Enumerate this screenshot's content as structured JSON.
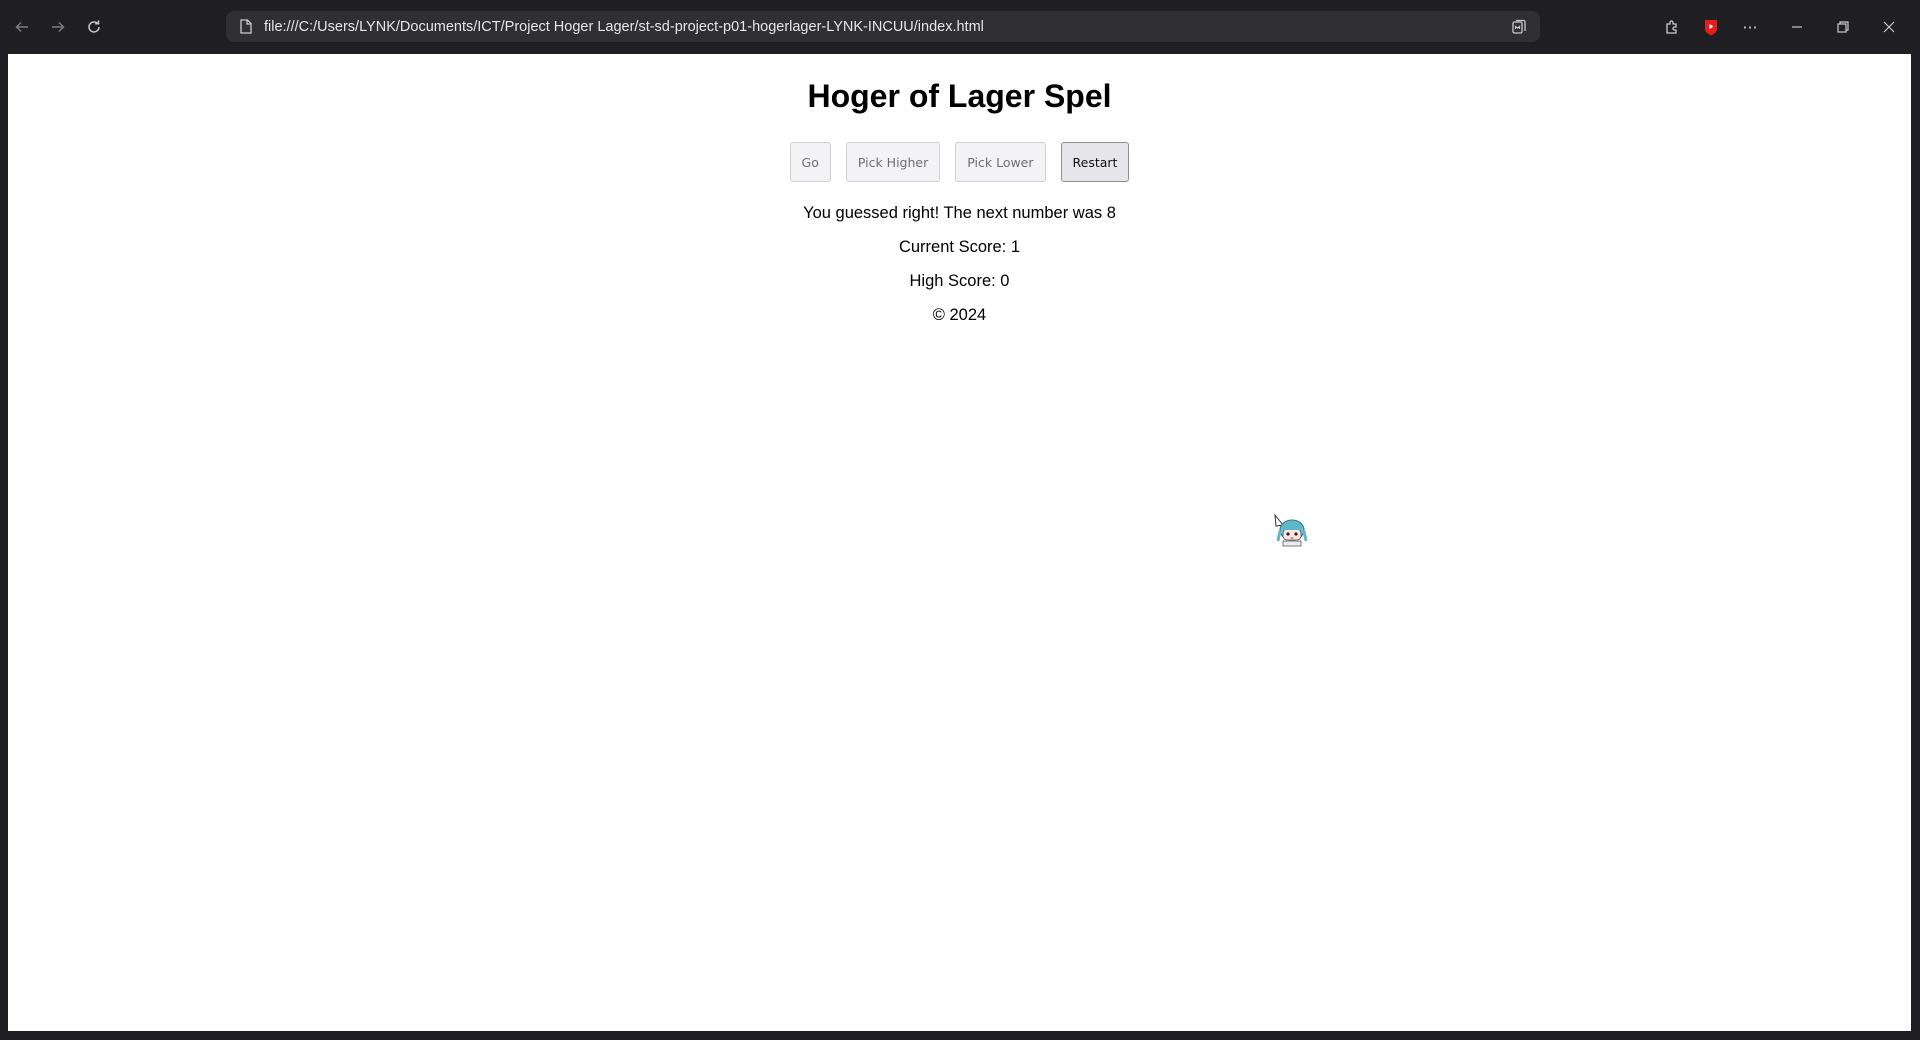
{
  "browser": {
    "url": "file:///C:/Users/LYNK/Documents/ICT/Project Hoger Lager/st-sd-project-p01-hogerlager-LYNK-INCUU/index.html",
    "icons": [
      "back-arrow-icon",
      "forward-arrow-icon",
      "reload-icon",
      "page-icon",
      "reader-view-icon",
      "extensions-icon",
      "youtube-icon",
      "more-icon",
      "minimize-icon",
      "restore-icon",
      "close-icon"
    ],
    "youtube_color": "#ff0000"
  },
  "page": {
    "title": "Hoger of Lager Spel",
    "buttons": {
      "go": "Go",
      "pick_higher": "Pick Higher",
      "pick_lower": "Pick Lower",
      "restart": "Restart"
    },
    "message": "You guessed right! The next number was 8",
    "current_score": "Current Score: 1",
    "high_score": "High Score: 0",
    "footer": "© 2024"
  },
  "cursor": {
    "type": "anime-girl-cursor-icon",
    "color": "#5fb8c8"
  }
}
